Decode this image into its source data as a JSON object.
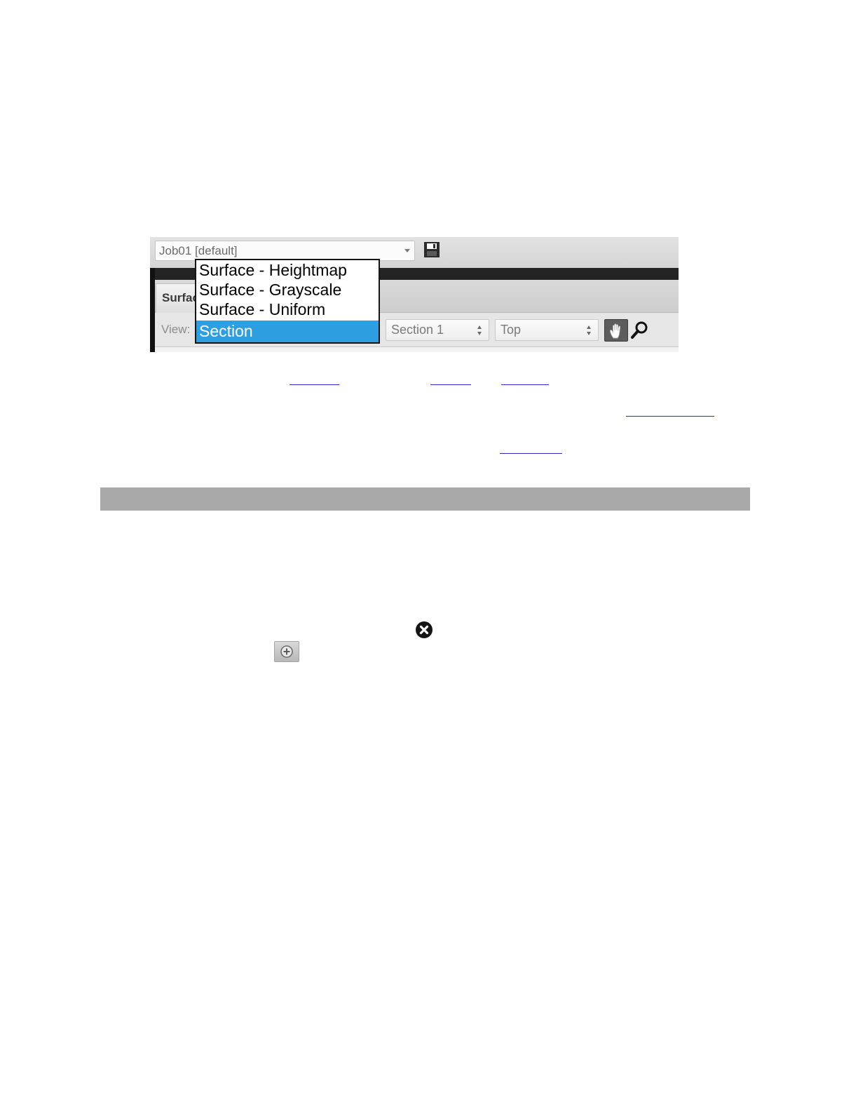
{
  "toolbar": {
    "job_select_value": "Job01 [default]"
  },
  "tabs": {
    "active_label": "Surface"
  },
  "view_row": {
    "view_label": "View:",
    "section_value": "Section 1",
    "orientation_value": "Top"
  },
  "dropdown": {
    "items": [
      {
        "label": "Surface - Heightmap",
        "selected": false
      },
      {
        "label": "Surface - Grayscale",
        "selected": false
      },
      {
        "label": "Surface - Uniform",
        "selected": false
      },
      {
        "label": "Section",
        "selected": true
      }
    ]
  },
  "colors": {
    "selection": "#2d9fe0",
    "link": "#2a2ad0",
    "section_bar": "#a9a9a9"
  },
  "icons": [
    "save-icon",
    "pan-hand-icon",
    "zoom-magnifier-icon",
    "remove-circle-icon",
    "add-circle-icon"
  ]
}
